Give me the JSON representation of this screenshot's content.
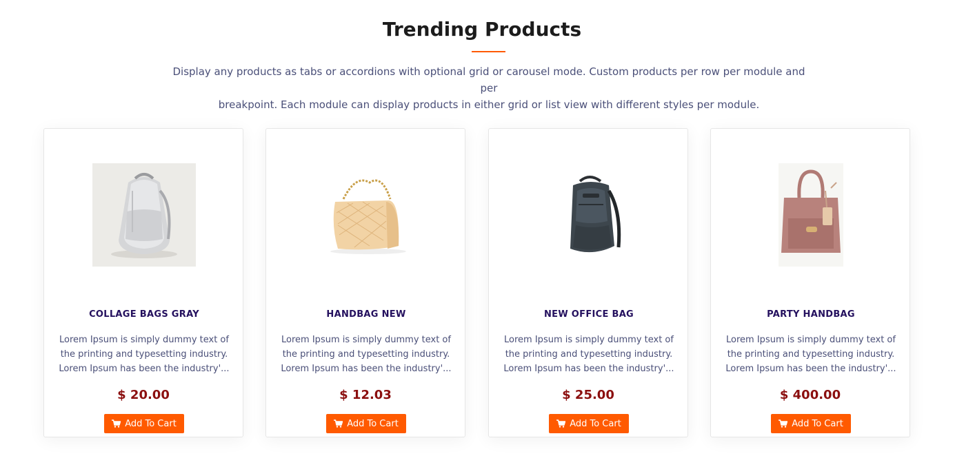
{
  "section": {
    "heading": "Trending Products",
    "subtitle_line1": "Display any products as tabs or accordions with optional grid or carousel mode. Custom products per row per module and per",
    "subtitle_line2": "breakpoint. Each module can display products in either grid or list view with different styles per module."
  },
  "colors": {
    "accent": "#ff5a00",
    "title": "#24105e",
    "price": "#8b0f0f"
  },
  "products": [
    {
      "title": "COLLAGE BAGS GRAY",
      "desc_line1": "Lorem Ipsum is simply dummy text of",
      "desc_line2": "the printing and typesetting industry.",
      "desc_line3": "Lorem Ipsum has been the industry'...",
      "price": "$ 20.00",
      "button": "Add To Cart",
      "image_icon": "gray-backpack-image"
    },
    {
      "title": "HANDBAG NEW",
      "desc_line1": "Lorem Ipsum is simply dummy text of",
      "desc_line2": "the printing and typesetting industry.",
      "desc_line3": "Lorem Ipsum has been the industry'...",
      "price": "$ 12.03",
      "button": "Add To Cart",
      "image_icon": "quilted-handbag-image"
    },
    {
      "title": "NEW OFFICE BAG",
      "desc_line1": "Lorem Ipsum is simply dummy text of",
      "desc_line2": "the printing and typesetting industry.",
      "desc_line3": "Lorem Ipsum has been the industry'...",
      "price": "$ 25.00",
      "button": "Add To Cart",
      "image_icon": "dark-backpack-image"
    },
    {
      "title": "PARTY HANDBAG",
      "desc_line1": "Lorem Ipsum is simply dummy text of",
      "desc_line2": "the printing and typesetting industry.",
      "desc_line3": "Lorem Ipsum has been the industry'...",
      "price": "$ 400.00",
      "button": "Add To Cart",
      "image_icon": "pink-tote-image"
    }
  ]
}
